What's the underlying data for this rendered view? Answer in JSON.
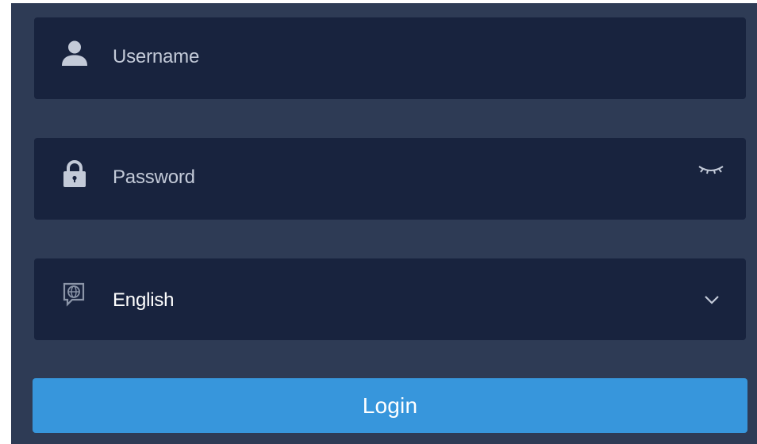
{
  "form": {
    "username": {
      "placeholder": "Username",
      "icon": "user-icon"
    },
    "password": {
      "placeholder": "Password",
      "icon": "lock-icon",
      "toggle_icon": "eye-closed-icon"
    },
    "language": {
      "selected": "English",
      "icon": "language-globe-icon",
      "dropdown_icon": "chevron-down-icon"
    },
    "login_label": "Login"
  },
  "colors": {
    "panel": "#2e3b55",
    "field": "#18233e",
    "accent": "#3796dc",
    "placeholder": "#c3cad8"
  }
}
